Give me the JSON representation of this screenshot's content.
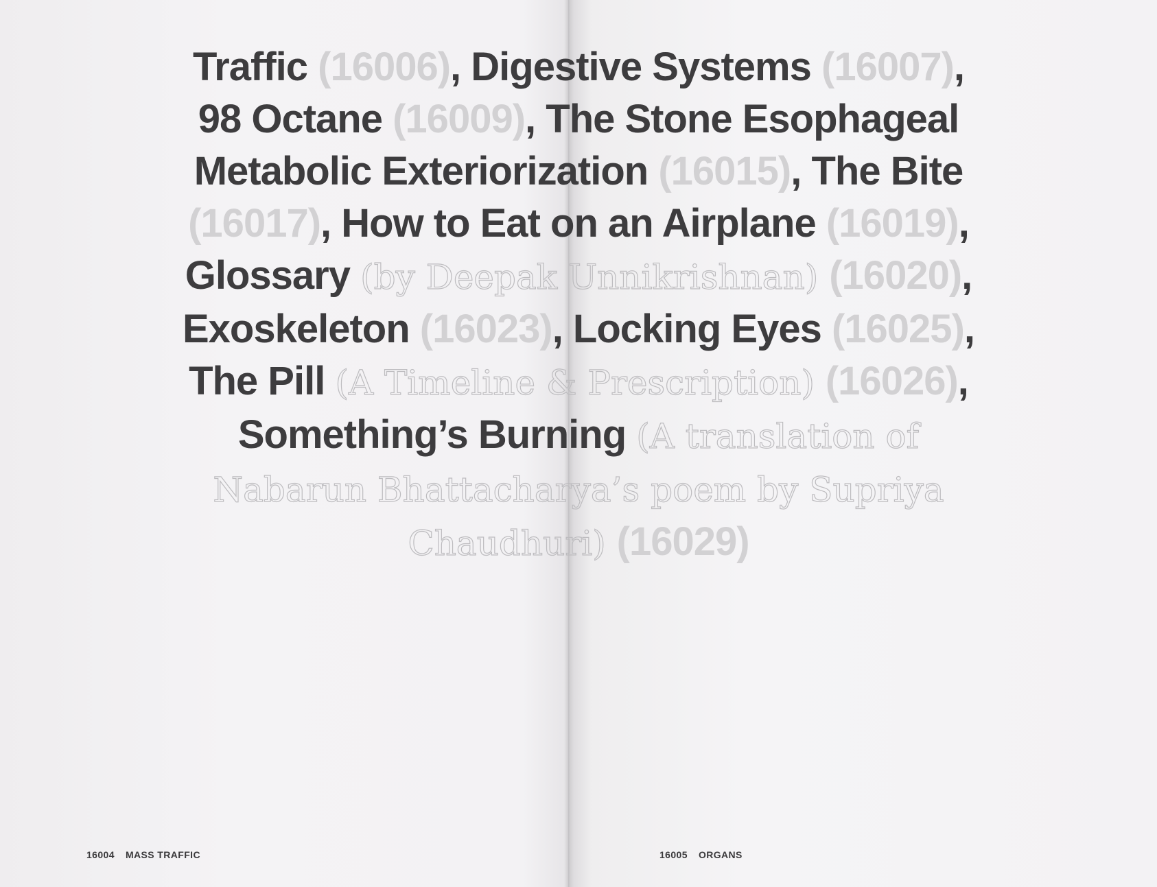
{
  "contents": {
    "lines": [
      {
        "parts": [
          {
            "text": "Traffic ",
            "style": "t"
          },
          {
            "text": "(16006)",
            "style": "n"
          },
          {
            "text": ", Digestive Systems ",
            "style": "t"
          },
          {
            "text": "(16007)",
            "style": "n"
          },
          {
            "text": ",",
            "style": "t"
          }
        ]
      },
      {
        "parts": [
          {
            "text": "98 Octane ",
            "style": "t"
          },
          {
            "text": "(16009)",
            "style": "n"
          },
          {
            "text": ", The Stone Esophageal",
            "style": "t"
          }
        ]
      },
      {
        "parts": [
          {
            "text": "Metabolic Exteriorization ",
            "style": "t"
          },
          {
            "text": "(16015)",
            "style": "n"
          },
          {
            "text": ", The Bite",
            "style": "t"
          }
        ]
      },
      {
        "parts": [
          {
            "text": "(16017)",
            "style": "n"
          },
          {
            "text": ", How to Eat on an Airplane ",
            "style": "t"
          },
          {
            "text": "(16019)",
            "style": "n"
          },
          {
            "text": ",",
            "style": "t"
          }
        ]
      },
      {
        "parts": [
          {
            "text": "Glossary ",
            "style": "t"
          },
          {
            "text": "(by Deepak Unnikrishnan) ",
            "style": "o"
          },
          {
            "text": "(16020)",
            "style": "n"
          },
          {
            "text": ",",
            "style": "t"
          }
        ]
      },
      {
        "parts": [
          {
            "text": "Exoskeleton ",
            "style": "t"
          },
          {
            "text": "(16023)",
            "style": "n"
          },
          {
            "text": ", Locking Eyes ",
            "style": "t"
          },
          {
            "text": "(16025)",
            "style": "n"
          },
          {
            "text": ",",
            "style": "t"
          }
        ]
      },
      {
        "parts": [
          {
            "text": "The Pill ",
            "style": "t"
          },
          {
            "text": "(A Timeline & Prescription) ",
            "style": "o"
          },
          {
            "text": "(16026)",
            "style": "n"
          },
          {
            "text": ",",
            "style": "t"
          }
        ]
      },
      {
        "parts": [
          {
            "text": "Something’s Burning ",
            "style": "t"
          },
          {
            "text": "(A translation of",
            "style": "o"
          }
        ]
      },
      {
        "parts": [
          {
            "text": "Nabarun Bhattacharya’s poem by Supriya",
            "style": "o"
          }
        ]
      },
      {
        "parts": [
          {
            "text": "Chaudhuri) ",
            "style": "o"
          },
          {
            "text": "(16029)",
            "style": "n"
          }
        ]
      }
    ]
  },
  "footer": {
    "left": {
      "number": "16004",
      "label": "MASS TRAFFIC"
    },
    "right": {
      "number": "16005",
      "label": "ORGANS"
    }
  }
}
